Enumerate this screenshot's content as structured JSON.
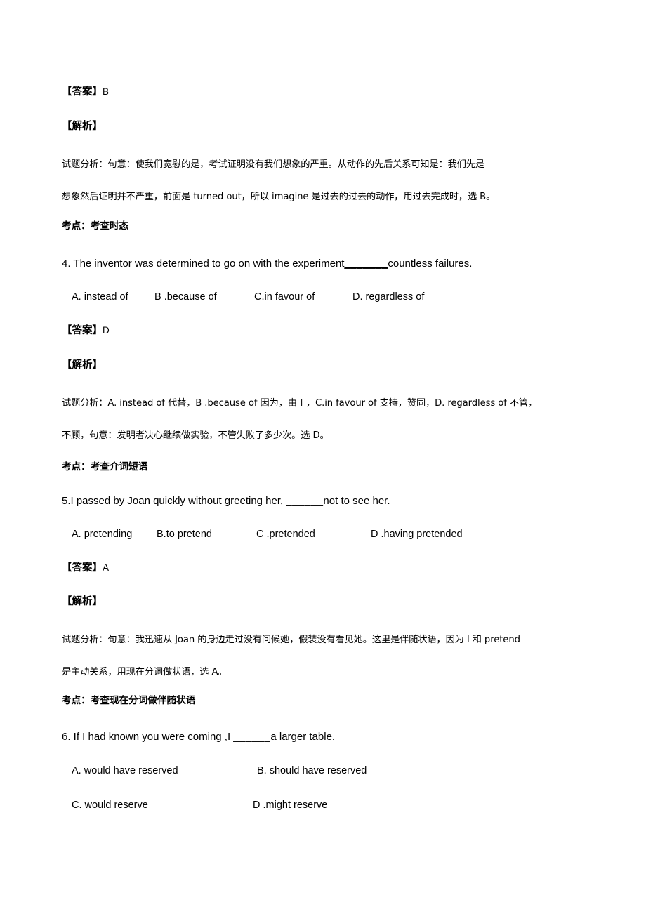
{
  "document": {
    "type": "exam-answer-explanation-page",
    "language": "zh-CN + en"
  },
  "labels": {
    "answer_tag": "【答案】",
    "explanation_tag": "【解析】",
    "analysis_prefix": "试题分析：",
    "point_prefix": "考点："
  },
  "blocks": {
    "q3_answer_value": "B",
    "q3_analysis_line1": "试题分析：句意：使我们宽慰的是，考试证明没有我们想象的严重。从动作的先后关系可知是：我们先是",
    "q3_analysis_line2": "想象然后证明并不严重，前面是 turned out，所以 imagine 是过去的过去的动作，用过去完成时，选 B。",
    "q3_point": "考点：考查时态",
    "q4_stem_pre": "4. The inventor was determined to go on with the experiment",
    "q4_stem_blank": "_______",
    "q4_stem_post": "countless failures.",
    "q4_options": [
      "A. instead of",
      "B .because of",
      "C.in favour of",
      "D. regardless of"
    ],
    "q4_answer_value": "D",
    "q4_analysis_line1": "试题分析：A. instead of 代替，B .because of 因为，由于，C.in favour of 支持，赞同，D. regardless of 不管，",
    "q4_analysis_line2": "不顾，句意：发明者决心继续做实验，不管失败了多少次。选 D。",
    "q4_point": "考点：考查介词短语",
    "q5_stem_pre": "5.I passed by Joan quickly without greeting her, ",
    "q5_stem_blank": "______",
    "q5_stem_post": "not to see her.",
    "q5_options": [
      "A. pretending",
      "B.to pretend",
      "C .pretended",
      "D .having pretended"
    ],
    "q5_answer_value": "A",
    "q5_analysis_line1": "试题分析：句意：我迅速从 Joan 的身边走过没有问候她，假装没有看见她。这里是伴随状语，因为 I 和 pretend",
    "q5_analysis_line2": "是主动关系，用现在分词做状语，选 A。",
    "q5_point": "考点：考查现在分词做伴随状语",
    "q6_stem_pre": "6. If I had known you were coming ,I ",
    "q6_stem_blank": "______",
    "q6_stem_post": "a larger table.",
    "q6_options_row1": [
      "A. would have reserved",
      "B. should have reserved"
    ],
    "q6_options_row2": [
      "C. would reserve",
      "D .might reserve"
    ]
  }
}
